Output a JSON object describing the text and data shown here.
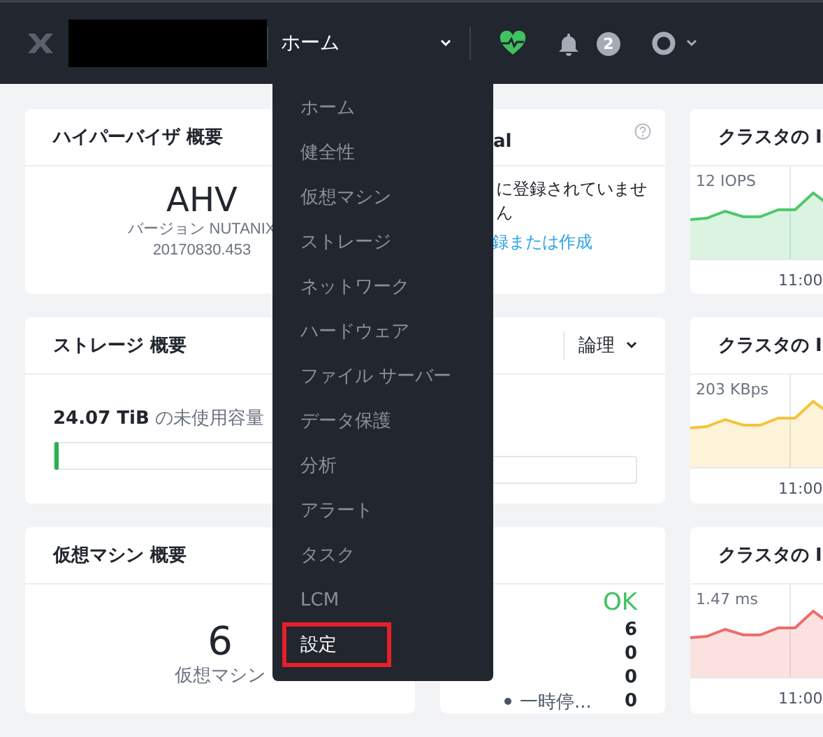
{
  "header": {
    "nav_label": "ホーム",
    "notification_count": "2"
  },
  "hypervisor_summary": {
    "title": "ハイパーバイザ 概要",
    "name": "AHV",
    "version": "バージョン NUTANIX",
    "build": "20170830.453"
  },
  "registration_card": {
    "title": "al",
    "message": "に登録されていません",
    "link": "録または作成"
  },
  "storage_summary": {
    "title": "ストレージ 概要",
    "free_capacity": "**24.07 TiB** の未使用容量",
    "level": 0.01
  },
  "storage_view": {
    "selector": "論理"
  },
  "vm_summary": {
    "title": "仮想マシン 概要",
    "count": "6",
    "count_label": "仮想マシン"
  },
  "vm_status": {
    "status": "OK",
    "rows": [
      {
        "value": "6"
      },
      {
        "value": "0"
      },
      {
        "value": "0"
      },
      {
        "label": "一時停...",
        "value": "0"
      }
    ]
  },
  "io_charts": [
    {
      "title": "クラスタの I",
      "reading": "12 IOPS",
      "time": "11:00",
      "color": "#4cc96b"
    },
    {
      "title": "クラスタの I",
      "reading": "203 KBps",
      "time": "11:00",
      "color": "#f5c33b"
    },
    {
      "title": "クラスタの I",
      "reading": "1.47 ms",
      "time": "11:00",
      "color": "#ef6b6b"
    }
  ],
  "nav_menu": {
    "items": [
      {
        "label": "ホーム",
        "selected": false
      },
      {
        "label": "健全性",
        "selected": false
      },
      {
        "label": "仮想マシン",
        "selected": false
      },
      {
        "label": "ストレージ",
        "selected": false
      },
      {
        "label": "ネットワーク",
        "selected": false
      },
      {
        "label": "ハードウェア",
        "selected": false
      },
      {
        "label": "ファイル サーバー",
        "selected": false
      },
      {
        "label": "データ保護",
        "selected": false
      },
      {
        "label": "分析",
        "selected": false
      },
      {
        "label": "アラート",
        "selected": false
      },
      {
        "label": "タスク",
        "selected": false
      },
      {
        "label": "LCM",
        "selected": false
      },
      {
        "label": "設定",
        "selected": true
      }
    ]
  }
}
